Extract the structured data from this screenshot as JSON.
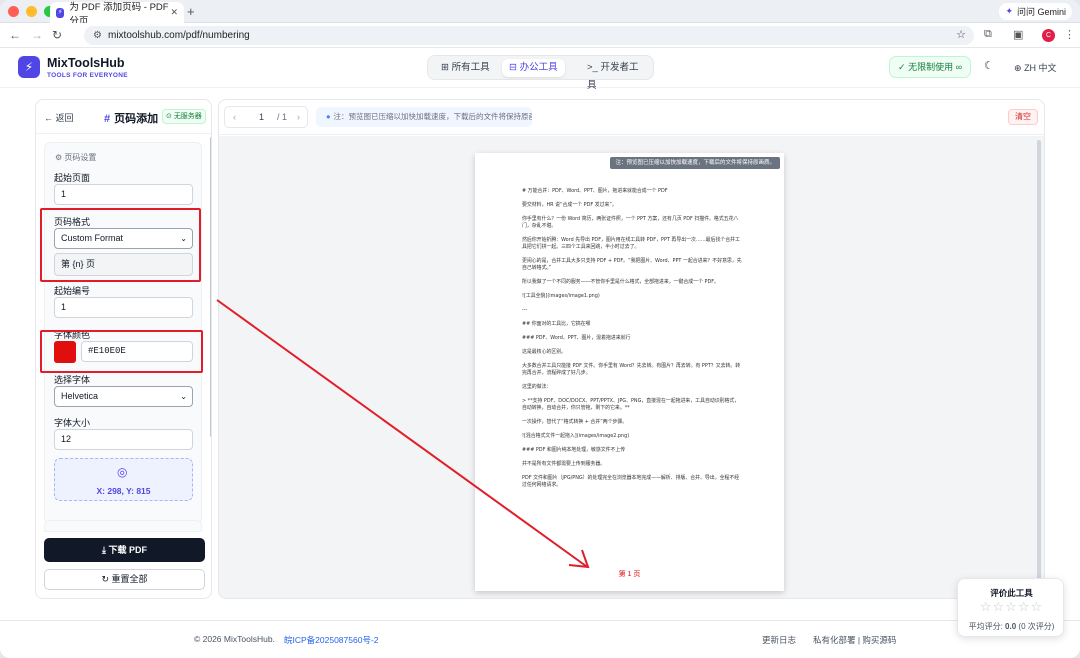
{
  "browser": {
    "tab_title": "为 PDF 添加页码 - PDF 分页",
    "url": "mixtoolshub.com/pdf/numbering",
    "gemini_label": "问问 Gemini",
    "profile_initial": "C"
  },
  "header": {
    "brand": "MixToolsHub",
    "tagline": "TOOLS FOR EVERYONE",
    "nav": [
      "所有工具",
      "办公工具",
      "开发者工具"
    ],
    "active_nav": "办公工具",
    "unlimited": "无限制使用",
    "lang": "ZH 中文"
  },
  "panel": {
    "back": "返回",
    "title": "页码添加",
    "no_server": "无服务器",
    "section": "页码设置",
    "start_page_label": "起始页面",
    "start_page_value": "1",
    "format_label": "页码格式",
    "format_value": "Custom Format",
    "template_value": "第 {n} 页",
    "start_number_label": "起始编号",
    "start_number_value": "1",
    "color_label": "字体颜色",
    "color_value": "#E10E0E",
    "font_label": "选择字体",
    "font_value": "Helvetica",
    "size_label": "字体大小",
    "size_value": "12",
    "position": "X: 298, Y: 815",
    "download": "下载 PDF",
    "reset": "重置全部"
  },
  "preview": {
    "page_current": "1",
    "page_total": "/ 1",
    "notice": "注：预览图已压缩以加快加载速度，下载后的文件将保持原画质。",
    "clear": "清空",
    "page_notice": "注：预览图已压缩以加快加载速度，下载后的文件将保持原画质。",
    "page_number_text": "第 1 页",
    "doc_lines": [
      "# 万能合并：PDF、Word、PPT、图片，拖进来就能合成一个 PDF",
      "要交材料，HR 说“合成一个 PDF 发过来”。",
      "你手里有什么？一份 Word 简历，两张证件照，一个 PPT 方案，还有几页 PDF 扫描件。格式五花八门，杂乱不堪。",
      "然后你开始折腾：Word 先导出 PDF，图片用在线工具转 PDF，PPT 再导出一次……最后找个合并工具把它们拼一起。三四个工具来回跳，半小时过去了。",
      "更闹心的是，合并工具大多只支持 PDF + PDF。“我把图片、Word、PPT 一起合进来？不好意思，先自己转格式。”",
      "所以我做了一个不同的服务——不管你手里是什么格式，全部拖进来，一键合成一个 PDF。",
      "![工具全貌](images/image1.png)",
      "---",
      "## 你面对的工具比，它搞在哪",
      "### PDF、Word、PPT、图片，混着拖进来就行",
      "这是最核心的区别。",
      "大多数合并工具只能接 PDF 文件。你手里有 Word？先去转。有图片？再去转。有 PPT？又去转。转完再合并，流程碎成了好几步。",
      "这里的做法：",
      "> **支持 PDF、DOC/DOCX、PPT/PPTX、JPG、PNG，直接混在一起拖进来，工具自动识别格式，自动转换，自动合并，你只管拖，剩下的它来。**",
      "一次操作，替代了“格式转换 + 合并”两个步骤。",
      "![混合格式文件一起拖入](images/image2.png)",
      "### PDF 和图片纯本地处理，敏感文件不上传",
      "并不是所有文件都需要上传到服务器。",
      "PDF 文件和图片（JPG/PNG）的处理完全在浏览器本地完成——解析、排版、合并、导出，全程不经过任何网络请求。"
    ]
  },
  "footer": {
    "copyright": "© 2026 MixToolsHub.",
    "icp": "皖ICP备2025087560号-2",
    "links": "更新日志　　私有化部署 | 购买源码"
  },
  "rating": {
    "title": "评价此工具",
    "stars": "☆☆☆☆☆",
    "average_label": "平均评分:",
    "average_value": "0.0",
    "count": "(0 次评分)"
  }
}
